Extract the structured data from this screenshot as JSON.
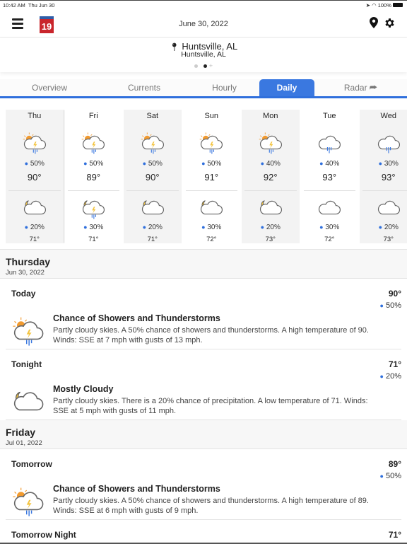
{
  "status": {
    "time": "10:42 AM",
    "date": "Thu Jun 30",
    "battery": "100%"
  },
  "header": {
    "logo": "19",
    "date": "June 30, 2022"
  },
  "location": {
    "title": "Huntsville, AL",
    "subtitle": "Huntsville, AL"
  },
  "tabs": [
    {
      "label": "Overview"
    },
    {
      "label": "Currents"
    },
    {
      "label": "Hourly"
    },
    {
      "label": "Daily",
      "active": true
    },
    {
      "label": "Radar"
    }
  ],
  "accent": "#3a78e0",
  "days": [
    {
      "name": "Thu",
      "day_icon": "sun-cloud-storm",
      "day_precip": "50%",
      "high": "90°",
      "night_icon": "moon-cloud",
      "night_precip": "20%",
      "low": "71°",
      "selected": true
    },
    {
      "name": "Fri",
      "day_icon": "sun-cloud-storm",
      "day_precip": "50%",
      "high": "89°",
      "night_icon": "moon-cloud-storm",
      "night_precip": "30%",
      "low": "71°"
    },
    {
      "name": "Sat",
      "day_icon": "sun-cloud-storm",
      "day_precip": "50%",
      "high": "90°",
      "night_icon": "moon-cloud",
      "night_precip": "20%",
      "low": "71°"
    },
    {
      "name": "Sun",
      "day_icon": "sun-cloud-storm",
      "day_precip": "50%",
      "high": "91°",
      "night_icon": "moon-cloud",
      "night_precip": "30%",
      "low": "72°"
    },
    {
      "name": "Mon",
      "day_icon": "sun-cloud-storm",
      "day_precip": "40%",
      "high": "92°",
      "night_icon": "moon-cloud",
      "night_precip": "20%",
      "low": "73°"
    },
    {
      "name": "Tue",
      "day_icon": "cloud-rain",
      "day_precip": "40%",
      "high": "93°",
      "night_icon": "cloud",
      "night_precip": "30%",
      "low": "72°"
    },
    {
      "name": "Wed",
      "day_icon": "cloud-rain",
      "day_precip": "30%",
      "high": "93°",
      "night_icon": "cloud",
      "night_precip": "20%",
      "low": "73°"
    }
  ],
  "details": [
    {
      "day": "Thursday",
      "date": "Jun 30, 2022",
      "periods": [
        {
          "name": "Today",
          "temp": "90°",
          "precip": "50%",
          "icon": "sun-cloud-storm",
          "headline": "Chance of Showers and Thunderstorms",
          "text": "Partly cloudy skies.  A 50% chance of showers and thunderstorms.  A high temperature of 90.  Winds: SSE at 7 mph with gusts of 13 mph."
        },
        {
          "name": "Tonight",
          "temp": "71°",
          "precip": "20%",
          "icon": "moon-cloud",
          "headline": "Mostly Cloudy",
          "text": "Partly cloudy skies. There is a 20% chance of precipitation.  A low temperature of 71.  Winds: SSE at 5 mph with gusts of 11 mph."
        }
      ]
    },
    {
      "day": "Friday",
      "date": "Jul 01, 2022",
      "periods": [
        {
          "name": "Tomorrow",
          "temp": "89°",
          "precip": "50%",
          "icon": "sun-cloud-storm",
          "headline": "Chance of Showers and Thunderstorms",
          "text": "Partly cloudy skies.  A 50% chance of showers and thunderstorms.  A high temperature of 89.  Winds: SSE at 6 mph with gusts of 9 mph."
        },
        {
          "name": "Tomorrow Night",
          "temp": "71°"
        }
      ]
    }
  ]
}
